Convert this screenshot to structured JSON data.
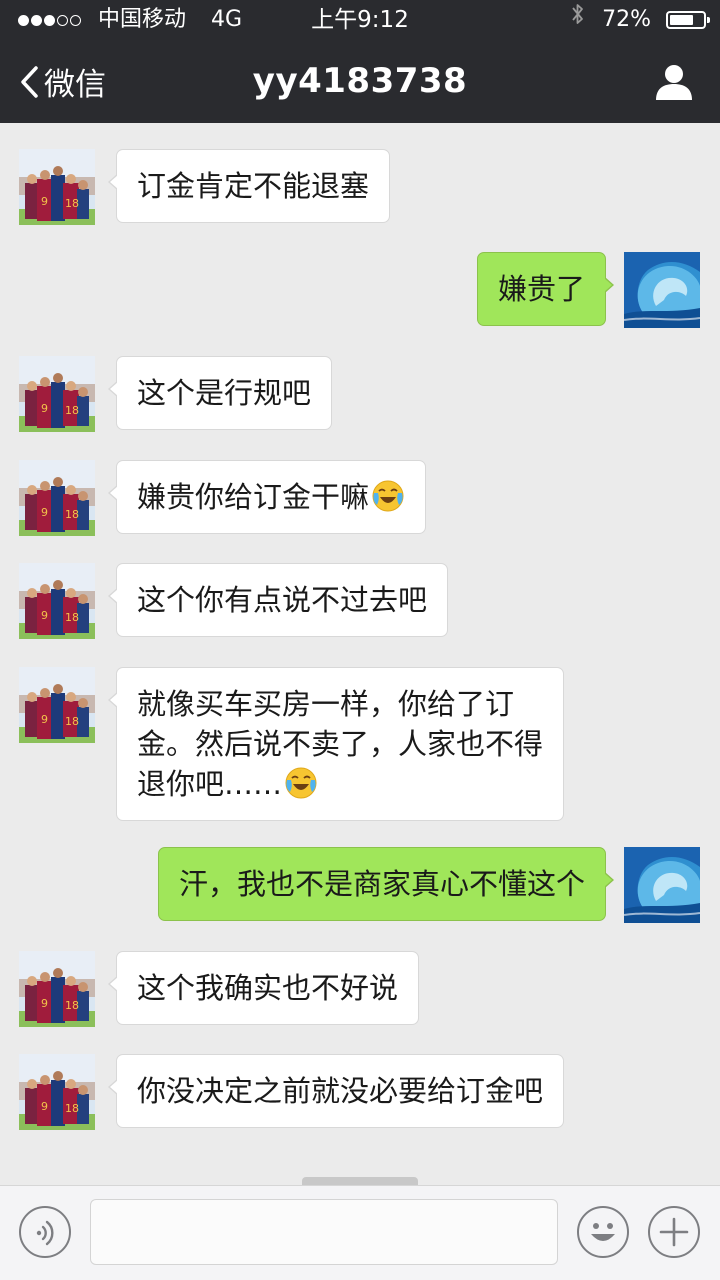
{
  "status_bar": {
    "signal_dots_filled": 3,
    "signal_dots_total": 5,
    "carrier": "中国移动",
    "network": "4G",
    "time": "上午9:12",
    "bluetooth_icon": "bluetooth-icon",
    "battery_text": "72%",
    "battery_level": 0.72
  },
  "nav": {
    "back_label": "微信",
    "title": "yy4183738",
    "profile_icon": "person-icon"
  },
  "messages": [
    {
      "side": "in",
      "text": "订金肯定不能退塞"
    },
    {
      "side": "out",
      "text": "嫌贵了"
    },
    {
      "side": "in",
      "text": "这个是行规吧"
    },
    {
      "side": "in",
      "text": "嫌贵你给订金干嘛",
      "emoji": "crying-laughing-emoji"
    },
    {
      "side": "in",
      "text": "这个你有点说不过去吧"
    },
    {
      "side": "in",
      "text": "就像买车买房一样，你给了订\n金。然后说不卖了，人家也不得\n退你吧……",
      "emoji": "crying-laughing-emoji"
    },
    {
      "side": "out",
      "text": "汗，我也不是商家真心不懂这个"
    },
    {
      "side": "in",
      "text": "这个我确实也不好说"
    },
    {
      "side": "in",
      "text": "你没决定之前就没必要给订金吧"
    }
  ],
  "input_bar": {
    "voice_icon": "voice-icon",
    "input_value": "",
    "emoji_icon": "smiley-icon",
    "more_icon": "plus-icon"
  },
  "colors": {
    "header_bg": "#2a2b2f",
    "chat_bg": "#ebebeb",
    "outgoing_bubble": "#a0e65a",
    "incoming_bubble": "#ffffff"
  }
}
